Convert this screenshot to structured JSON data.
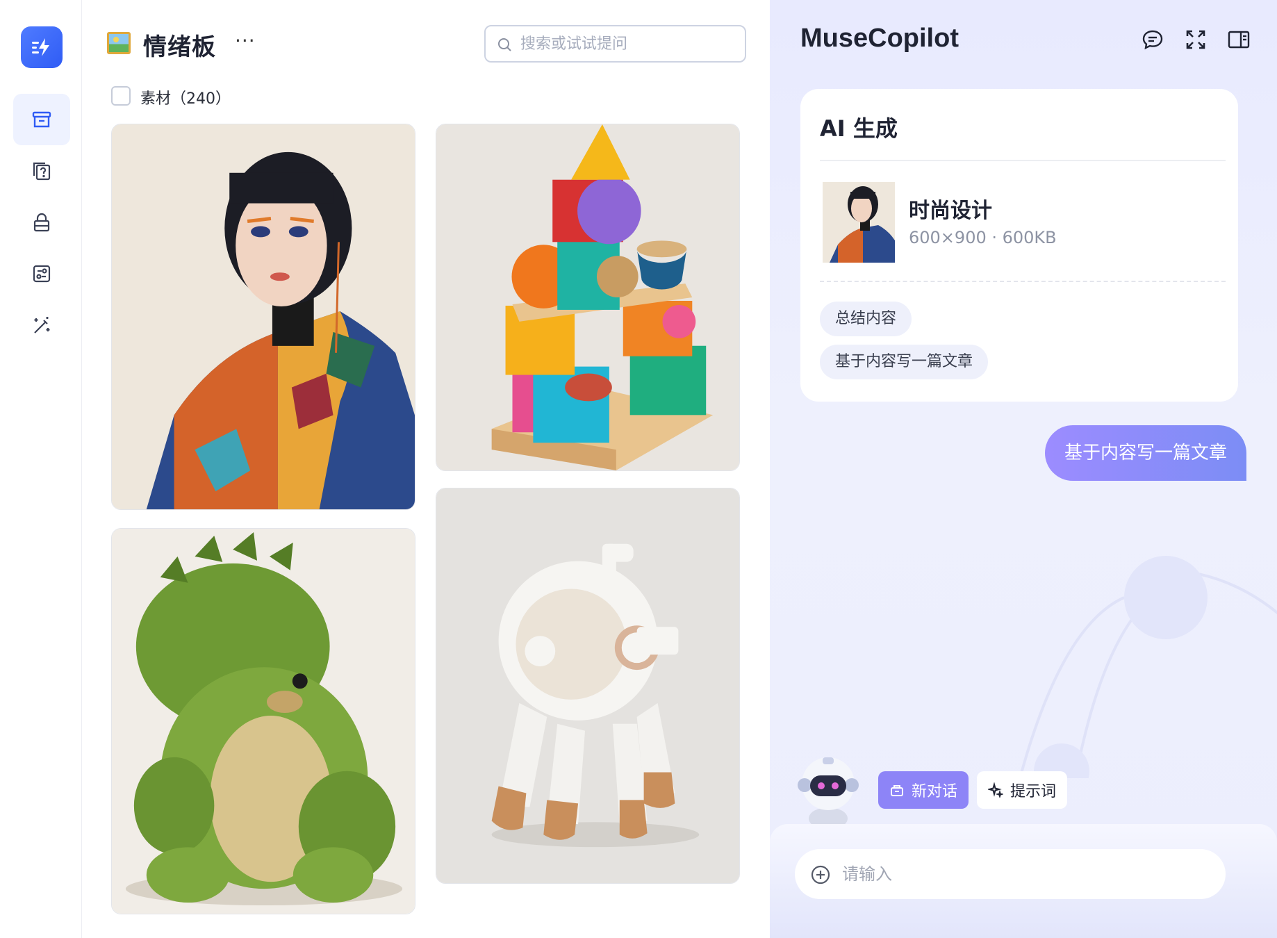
{
  "sidebar": {
    "logo_icon": "bolt-menu-icon",
    "items": [
      {
        "icon": "archive-box-icon",
        "active": true
      },
      {
        "icon": "help-cards-icon",
        "active": false
      },
      {
        "icon": "lock-icon",
        "active": false
      },
      {
        "icon": "sliders-panel-icon",
        "active": false
      },
      {
        "icon": "magic-wand-icon",
        "active": false
      }
    ]
  },
  "board": {
    "title": "情绪板",
    "more": "···",
    "search_placeholder": "搜索或试试提问",
    "materials_label": "素材（240）",
    "cards": [
      {
        "subject": "fashion-portrait"
      },
      {
        "subject": "wooden-block-tower"
      },
      {
        "subject": "green-plush-dinosaur"
      },
      {
        "subject": "white-robot-vehicle"
      }
    ]
  },
  "copilot": {
    "title": "MuseCopilot",
    "tools": [
      "chat-bubble-icon",
      "fullscreen-icon",
      "sidebar-panel-icon"
    ],
    "ai_card": {
      "title": "AI 生成",
      "file_name": "时尚设计",
      "file_meta": "600×900 · 600KB",
      "chips": [
        "总结内容",
        "基于内容写一篇文章"
      ]
    },
    "user_message": "基于内容写一篇文章",
    "new_chat": "新对话",
    "prompt_words": "提示词",
    "input_placeholder": "请输入"
  },
  "colors": {
    "accent": "#2f5cf5",
    "copilot_bg": "#e8eafe",
    "bubble": "#8d84f7"
  }
}
